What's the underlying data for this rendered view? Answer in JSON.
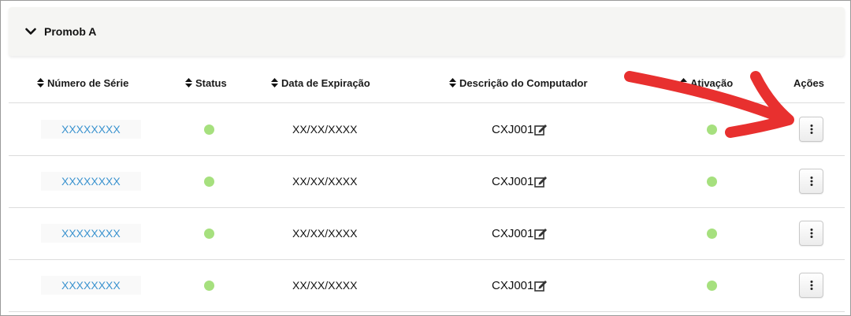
{
  "panel": {
    "title": "Promob A",
    "toggle_icon": "chevron-down-icon"
  },
  "table": {
    "headers": {
      "serial": "Número de Série",
      "status": "Status",
      "expiration": "Data de Expiração",
      "description": "Descrição do Computador",
      "activation": "Ativação",
      "actions": "Ações"
    },
    "rows": [
      {
        "serial": "XXXXXXXX",
        "status": "active",
        "expiration": "XX/XX/XXXX",
        "description": "CXJ001",
        "activation": "active"
      },
      {
        "serial": "XXXXXXXX",
        "status": "active",
        "expiration": "XX/XX/XXXX",
        "description": "CXJ001",
        "activation": "active"
      },
      {
        "serial": "XXXXXXXX",
        "status": "active",
        "expiration": "XX/XX/XXXX",
        "description": "CXJ001",
        "activation": "active"
      },
      {
        "serial": "XXXXXXXX",
        "status": "active",
        "expiration": "XX/XX/XXXX",
        "description": "CXJ001",
        "activation": "active"
      }
    ]
  },
  "colors": {
    "link": "#3b93cf",
    "status_dot": "#a6e07e",
    "annotation_arrow": "#e8302f"
  },
  "icons": {
    "sort": "sort-icon",
    "edit": "edit-icon",
    "actions": "kebab-menu-icon"
  }
}
